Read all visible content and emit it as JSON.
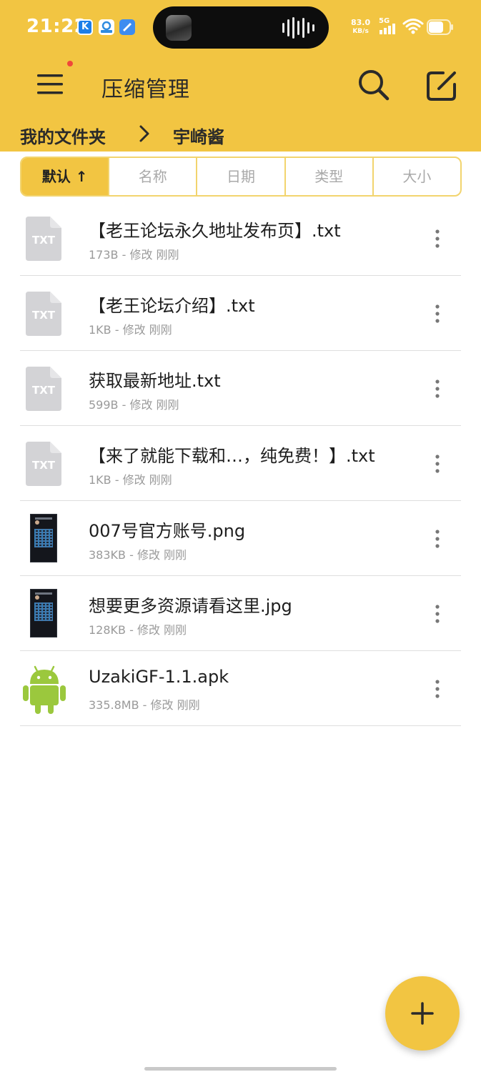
{
  "status_bar": {
    "time": "21:22",
    "apps": [
      {
        "icon": "kuaishou-app-icon",
        "letter": "K",
        "color": "#1d7ee8"
      },
      {
        "icon": "store-app-icon",
        "letter": "",
        "color": "#2f8be0"
      },
      {
        "icon": "browser-app-icon",
        "letter": "",
        "color": "#3d8cf0"
      }
    ],
    "net_speed_value": "83.0",
    "net_speed_unit": "KB/s",
    "network_type": "5G",
    "battery_level": 0.72
  },
  "toolbar": {
    "title": "压缩管理",
    "has_notification": true
  },
  "breadcrumb": {
    "root": "我的文件夹",
    "current": "宇崎酱"
  },
  "sort_tabs": [
    {
      "label": "默认 ↑",
      "active": true
    },
    {
      "label": "名称",
      "active": false
    },
    {
      "label": "日期",
      "active": false
    },
    {
      "label": "类型",
      "active": false
    },
    {
      "label": "大小",
      "active": false
    }
  ],
  "files": [
    {
      "name": "【老王论坛永久地址发布页】.txt",
      "meta": "173B - 修改 刚刚",
      "type": "txt",
      "type_label": "TXT"
    },
    {
      "name": "【老王论坛介绍】.txt",
      "meta": "1KB - 修改 刚刚",
      "type": "txt",
      "type_label": "TXT"
    },
    {
      "name": "获取最新地址.txt",
      "meta": "599B - 修改 刚刚",
      "type": "txt",
      "type_label": "TXT"
    },
    {
      "name": "【来了就能下载和…，纯免费！】.txt",
      "meta": "1KB - 修改 刚刚",
      "type": "txt",
      "type_label": "TXT"
    },
    {
      "name": "007号官方账号.png",
      "meta": "383KB - 修改 刚刚",
      "type": "image"
    },
    {
      "name": "想要更多资源请看这里.jpg",
      "meta": "128KB - 修改 刚刚",
      "type": "image"
    },
    {
      "name": "UzakiGF-1.1.apk",
      "meta": "335.8MB - 修改 刚刚",
      "type": "apk"
    }
  ],
  "colors": {
    "accent": "#f2c542",
    "tab_border": "#f2d46e",
    "android_green": "#9bc83d",
    "txt_icon": "#d3d3d6"
  }
}
